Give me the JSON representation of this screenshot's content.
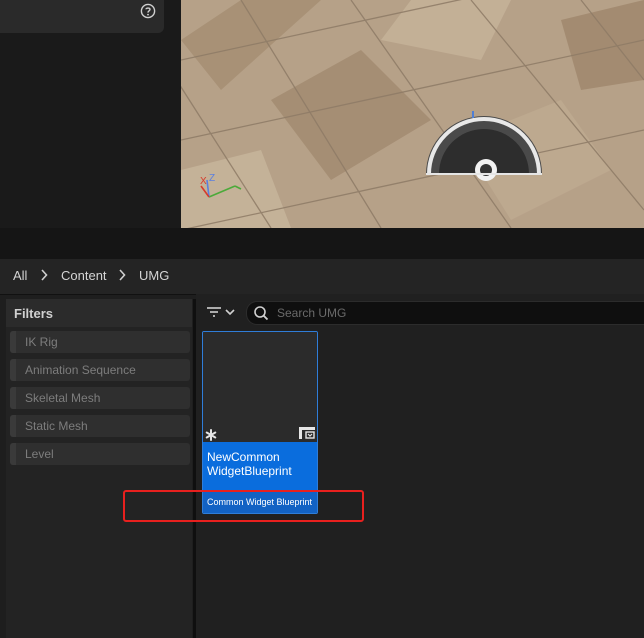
{
  "breadcrumb": {
    "items": [
      "All",
      "Content",
      "UMG"
    ]
  },
  "filters": {
    "title": "Filters",
    "items": [
      "IK Rig",
      "Animation Sequence",
      "Skeletal Mesh",
      "Static Mesh",
      "Level"
    ]
  },
  "search": {
    "placeholder": "Search UMG",
    "value": ""
  },
  "asset": {
    "name": "NewCommon WidgetBlueprint",
    "type": "Common Widget Blueprint"
  },
  "viewport": {
    "axis_labels": [
      "X",
      "Z"
    ]
  },
  "icons": [
    "help-icon",
    "filter-icon",
    "chevron-down-icon",
    "search-icon",
    "asset-badge-icon",
    "widget-blueprint-icon",
    "chevron-right-icon"
  ],
  "colors": {
    "selection_blue": "#0a6ddd",
    "highlight_red": "#e8201e"
  }
}
